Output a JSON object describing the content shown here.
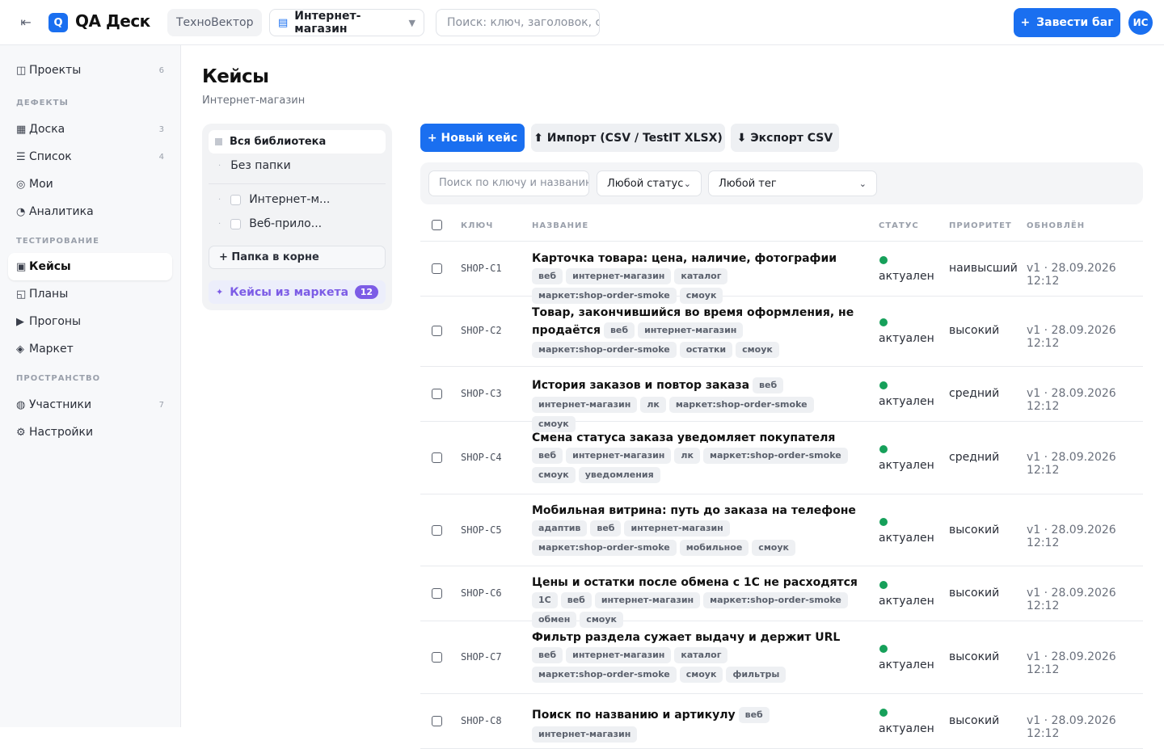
{
  "topbar": {
    "brand": "QA Деск",
    "logo_letter": "Q",
    "org": "ТехноВектор",
    "project": "Интернет-магазин",
    "search_placeholder": "Поиск: ключ, заголовок, с",
    "bug_button": "Завести баг",
    "avatar": "ИС"
  },
  "sidebar": {
    "top": {
      "label": "Проекты",
      "count": "6",
      "icon": "projects-icon"
    },
    "sections": [
      {
        "title": "ДЕФЕКТЫ",
        "items": [
          {
            "label": "Доска",
            "count": "3",
            "icon": "board-icon"
          },
          {
            "label": "Список",
            "count": "4",
            "icon": "list-icon"
          },
          {
            "label": "Мои",
            "count": "",
            "icon": "target-icon"
          },
          {
            "label": "Аналитика",
            "count": "",
            "icon": "pie-icon"
          }
        ]
      },
      {
        "title": "ТЕСТИРОВАНИЕ",
        "items": [
          {
            "label": "Кейсы",
            "count": "",
            "icon": "cases-icon",
            "active": true
          },
          {
            "label": "Планы",
            "count": "",
            "icon": "plans-icon"
          },
          {
            "label": "Прогоны",
            "count": "",
            "icon": "play-icon"
          },
          {
            "label": "Маркет",
            "count": "",
            "icon": "diamond-icon"
          }
        ]
      },
      {
        "title": "ПРОСТРАНСТВО",
        "items": [
          {
            "label": "Участники",
            "count": "7",
            "icon": "members-icon"
          },
          {
            "label": "Настройки",
            "count": "",
            "icon": "gear-icon"
          }
        ]
      }
    ]
  },
  "page": {
    "title": "Кейсы",
    "subtitle": "Интернет-магазин"
  },
  "tree": {
    "all": "Вся библиотека",
    "no_folder": "Без папки",
    "folders": [
      "Интернет-м...",
      "Веб-прило..."
    ],
    "add_root": "+ Папка в корне",
    "market": "Кейсы из маркета",
    "market_count": "12"
  },
  "toolbar": {
    "new_case": "+ Новый кейс",
    "import": "⬆ Импорт (CSV / TestIT XLSX)",
    "export": "⬇ Экспорт CSV"
  },
  "filters": {
    "search_placeholder": "Поиск по ключу и названию",
    "status": "Любой статус",
    "tag": "Любой тег"
  },
  "table": {
    "headers": {
      "key": "КЛЮЧ",
      "title": "НАЗВАНИЕ",
      "status": "СТАТУС",
      "priority": "ПРИОРИТЕТ",
      "updated": "ОБНОВЛЁН"
    },
    "rows": [
      {
        "key": "SHOP-C1",
        "title": "Карточка товара: цена, наличие, фотографии",
        "tags": [
          "веб",
          "интернет-магазин",
          "каталог",
          "маркет:shop-order-smoke",
          "смоук"
        ],
        "status": "актуален",
        "priority": "наивысший",
        "updated": "v1 · 28.09.2026 12:12"
      },
      {
        "key": "SHOP-C2",
        "title": "Товар, закончившийся во время оформления, не продаётся",
        "tags": [
          "веб",
          "интернет-магазин",
          "маркет:shop-order-smoke",
          "остатки",
          "смоук"
        ],
        "status": "актуален",
        "priority": "высокий",
        "updated": "v1 · 28.09.2026 12:12"
      },
      {
        "key": "SHOP-C3",
        "title": "История заказов и повтор заказа",
        "tags": [
          "веб",
          "интернет-магазин",
          "лк",
          "маркет:shop-order-smoke",
          "смоук"
        ],
        "status": "актуален",
        "priority": "средний",
        "updated": "v1 · 28.09.2026 12:12"
      },
      {
        "key": "SHOP-C4",
        "title": "Смена статуса заказа уведомляет покупателя",
        "tags": [
          "веб",
          "интернет-магазин",
          "лк",
          "маркет:shop-order-smoke",
          "смоук",
          "уведомления"
        ],
        "status": "актуален",
        "priority": "средний",
        "updated": "v1 · 28.09.2026 12:12"
      },
      {
        "key": "SHOP-C5",
        "title": "Мобильная витрина: путь до заказа на телефоне",
        "tags": [
          "адаптив",
          "веб",
          "интернет-магазин",
          "маркет:shop-order-smoke",
          "мобильное",
          "смоук"
        ],
        "status": "актуален",
        "priority": "высокий",
        "updated": "v1 · 28.09.2026 12:12"
      },
      {
        "key": "SHOP-C6",
        "title": "Цены и остатки после обмена с 1С не расходятся",
        "tags": [
          "1С",
          "веб",
          "интернет-магазин",
          "маркет:shop-order-smoke",
          "обмен",
          "смоук"
        ],
        "status": "актуален",
        "priority": "высокий",
        "updated": "v1 · 28.09.2026 12:12"
      },
      {
        "key": "SHOP-C7",
        "title": "Фильтр раздела сужает выдачу и держит URL",
        "tags": [
          "веб",
          "интернет-магазин",
          "каталог",
          "маркет:shop-order-smoke",
          "смоук",
          "фильтры"
        ],
        "status": "актуален",
        "priority": "высокий",
        "updated": "v1 · 28.09.2026 12:12"
      },
      {
        "key": "SHOP-C8",
        "title": "Поиск по названию и артикулу",
        "tags": [
          "веб",
          "интернет-магазин"
        ],
        "status": "актуален",
        "priority": "высокий",
        "updated": "v1 · 28.09.2026 12:12"
      }
    ]
  },
  "colors": {
    "accent": "#1a6ff0",
    "market": "#7c5ce6",
    "status_ok": "#16a05a"
  }
}
